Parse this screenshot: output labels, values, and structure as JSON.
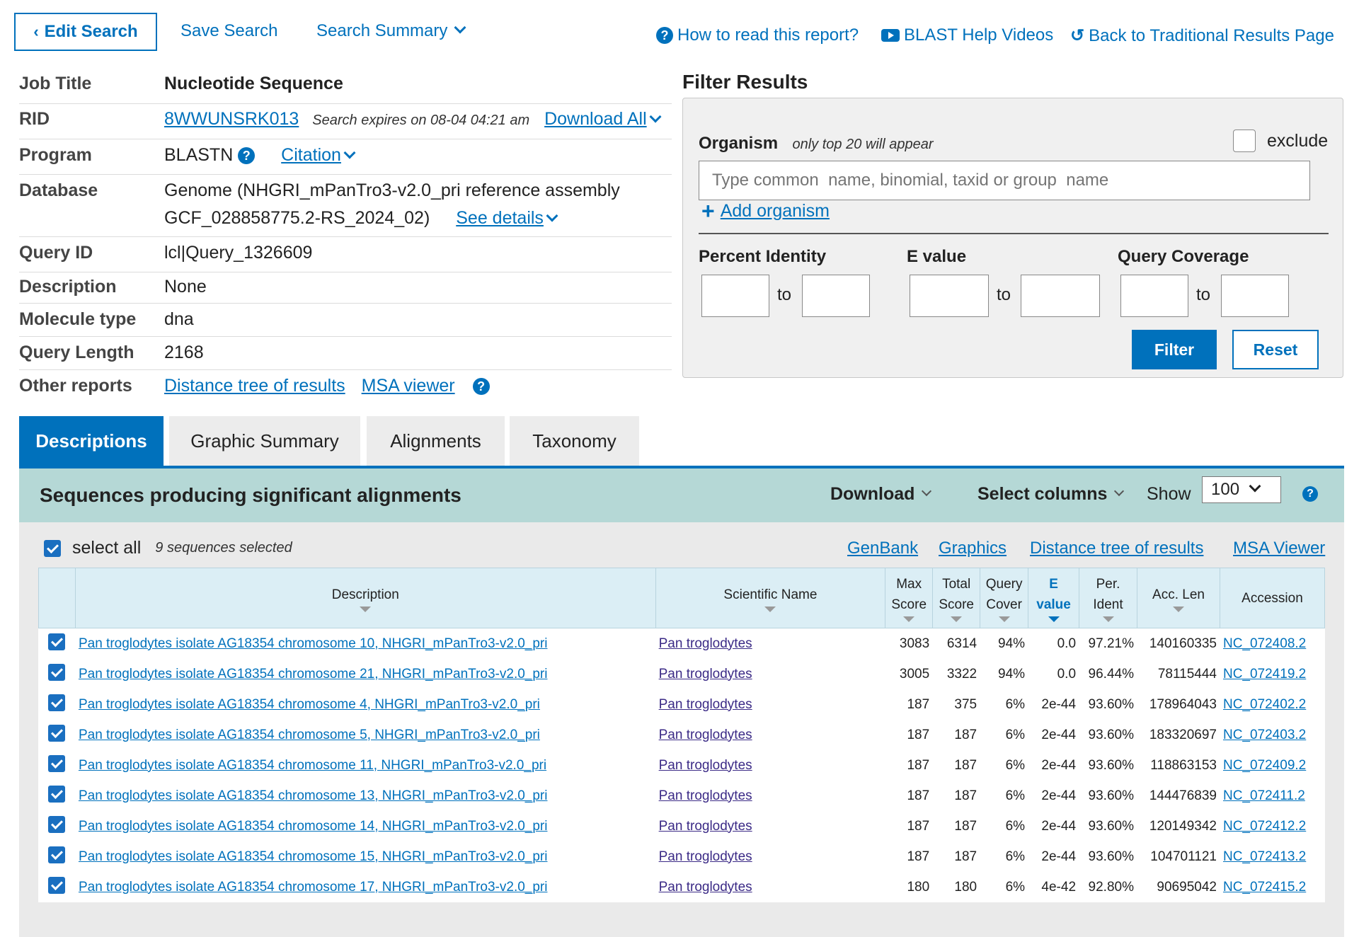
{
  "topbar": {
    "edit_search": "Edit Search",
    "save_search": "Save Search",
    "search_summary": "Search Summary",
    "how_to_read": "How to read this report?",
    "help_videos": "BLAST Help Videos",
    "back_traditional": "Back to Traditional Results Page"
  },
  "job": {
    "job_title_label": "Job Title",
    "job_title": "Nucleotide Sequence",
    "rid_label": "RID",
    "rid": "8WWUNSRK013",
    "expires": "Search expires on 08-04 04:21 am",
    "download_all": "Download All",
    "program_label": "Program",
    "program": "BLASTN",
    "citation": "Citation",
    "database_label": "Database",
    "database_line1": "Genome (NHGRI_mPanTro3-v2.0_pri reference assembly",
    "database_line2": "GCF_028858775.2-RS_2024_02)",
    "see_details": "See details",
    "query_id_label": "Query ID",
    "query_id": "lcl|Query_1326609",
    "description_label": "Description",
    "description": "None",
    "molecule_type_label": "Molecule type",
    "molecule_type": "dna",
    "query_length_label": "Query Length",
    "query_length": "2168",
    "other_reports_label": "Other reports",
    "distance_tree": "Distance tree of results",
    "msa_viewer": "MSA viewer"
  },
  "filter": {
    "title": "Filter Results",
    "organism_label": "Organism",
    "organism_note": "only top 20 will appear",
    "exclude_label": "exclude",
    "organism_placeholder": "Type common  name, binomial, taxid or group  name",
    "add_organism": "Add organism",
    "percent_identity": "Percent Identity",
    "e_value": "E value",
    "query_coverage": "Query Coverage",
    "to": "to",
    "filter_btn": "Filter",
    "reset_btn": "Reset"
  },
  "tabs": [
    "Descriptions",
    "Graphic Summary",
    "Alignments",
    "Taxonomy"
  ],
  "results": {
    "heading": "Sequences producing significant alignments",
    "download": "Download",
    "select_columns": "Select columns",
    "show_label": "Show",
    "show_value": "100",
    "select_all": "select all",
    "selected_count": "9 sequences selected",
    "links": {
      "genbank": "GenBank",
      "graphics": "Graphics",
      "distance_tree": "Distance tree of results",
      "msa_viewer": "MSA Viewer"
    },
    "columns": {
      "description": "Description",
      "scientific_name": "Scientific Name",
      "max_score_1": "Max",
      "max_score_2": "Score",
      "total_score_1": "Total",
      "total_score_2": "Score",
      "query_cover_1": "Query",
      "query_cover_2": "Cover",
      "e_value_1": "E",
      "e_value_2": "value",
      "per_ident_1": "Per.",
      "per_ident_2": "Ident",
      "acc_len": "Acc. Len",
      "accession": "Accession"
    },
    "rows": [
      {
        "desc": "Pan troglodytes isolate AG18354 chromosome 10, NHGRI_mPanTro3-v2.0_pri",
        "sci": "Pan troglodytes",
        "max": "3083",
        "total": "6314",
        "cover": "94%",
        "evalue": "0.0",
        "ident": "97.21%",
        "acclen": "140160335",
        "acc": "NC_072408.2"
      },
      {
        "desc": "Pan troglodytes isolate AG18354 chromosome 21, NHGRI_mPanTro3-v2.0_pri",
        "sci": "Pan troglodytes",
        "max": "3005",
        "total": "3322",
        "cover": "94%",
        "evalue": "0.0",
        "ident": "96.44%",
        "acclen": "78115444",
        "acc": "NC_072419.2"
      },
      {
        "desc": "Pan troglodytes isolate AG18354 chromosome 4, NHGRI_mPanTro3-v2.0_pri",
        "sci": "Pan troglodytes",
        "max": "187",
        "total": "375",
        "cover": "6%",
        "evalue": "2e-44",
        "ident": "93.60%",
        "acclen": "178964043",
        "acc": "NC_072402.2"
      },
      {
        "desc": "Pan troglodytes isolate AG18354 chromosome 5, NHGRI_mPanTro3-v2.0_pri",
        "sci": "Pan troglodytes",
        "max": "187",
        "total": "187",
        "cover": "6%",
        "evalue": "2e-44",
        "ident": "93.60%",
        "acclen": "183320697",
        "acc": "NC_072403.2"
      },
      {
        "desc": "Pan troglodytes isolate AG18354 chromosome 11, NHGRI_mPanTro3-v2.0_pri",
        "sci": "Pan troglodytes",
        "max": "187",
        "total": "187",
        "cover": "6%",
        "evalue": "2e-44",
        "ident": "93.60%",
        "acclen": "118863153",
        "acc": "NC_072409.2"
      },
      {
        "desc": "Pan troglodytes isolate AG18354 chromosome 13, NHGRI_mPanTro3-v2.0_pri",
        "sci": "Pan troglodytes",
        "max": "187",
        "total": "187",
        "cover": "6%",
        "evalue": "2e-44",
        "ident": "93.60%",
        "acclen": "144476839",
        "acc": "NC_072411.2"
      },
      {
        "desc": "Pan troglodytes isolate AG18354 chromosome 14, NHGRI_mPanTro3-v2.0_pri",
        "sci": "Pan troglodytes",
        "max": "187",
        "total": "187",
        "cover": "6%",
        "evalue": "2e-44",
        "ident": "93.60%",
        "acclen": "120149342",
        "acc": "NC_072412.2"
      },
      {
        "desc": "Pan troglodytes isolate AG18354 chromosome 15, NHGRI_mPanTro3-v2.0_pri",
        "sci": "Pan troglodytes",
        "max": "187",
        "total": "187",
        "cover": "6%",
        "evalue": "2e-44",
        "ident": "93.60%",
        "acclen": "104701121",
        "acc": "NC_072413.2"
      },
      {
        "desc": "Pan troglodytes isolate AG18354 chromosome 17, NHGRI_mPanTro3-v2.0_pri",
        "sci": "Pan troglodytes",
        "max": "180",
        "total": "180",
        "cover": "6%",
        "evalue": "4e-42",
        "ident": "92.80%",
        "acclen": "90695042",
        "acc": "NC_072415.2"
      }
    ]
  },
  "colors": {
    "link": "#0071bc",
    "tab_active": "#0071bc",
    "results_header": "#b5d8d6",
    "table_header": "#dbeef5"
  }
}
